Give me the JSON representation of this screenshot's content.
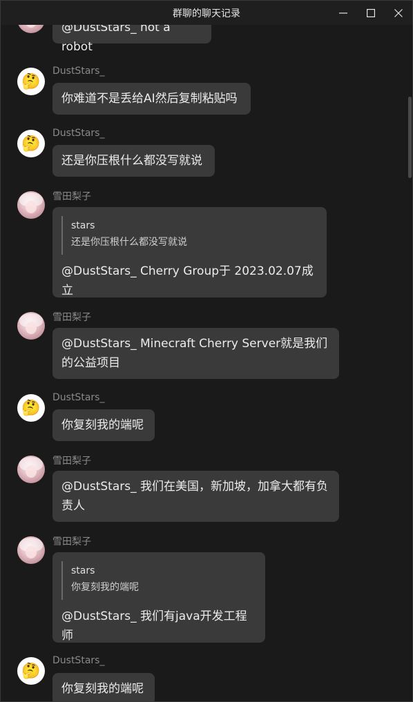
{
  "window": {
    "title": "群聊的聊天记录"
  },
  "icons": {
    "minimize": "minimize-icon",
    "maximize": "maximize-icon",
    "close": "close-icon",
    "thinking_emoji": "🤔"
  },
  "messages": [
    {
      "sender": "",
      "avatar": "photo",
      "text": "@DustStars_ not a robot"
    },
    {
      "sender": "DustStars_",
      "avatar": "emoji",
      "text": "你难道不是丢给AI然后复制粘贴吗"
    },
    {
      "sender": "DustStars_",
      "avatar": "emoji",
      "text": "还是你压根什么都没写就说"
    },
    {
      "sender": "雪田梨子",
      "avatar": "photo",
      "quote": {
        "name": "stars",
        "text": "还是你压根什么都没写就说"
      },
      "text": "@DustStars_ Cherry Group于 2023.02.07成立"
    },
    {
      "sender": "雪田梨子",
      "avatar": "photo",
      "text": "@DustStars_ Minecraft Cherry Server就是我们的公益项目"
    },
    {
      "sender": "DustStars_",
      "avatar": "emoji",
      "text": "你复刻我的端呢"
    },
    {
      "sender": "雪田梨子",
      "avatar": "photo",
      "text": "@DustStars_ 我们在美国，新加坡，加拿大都有负责人"
    },
    {
      "sender": "雪田梨子",
      "avatar": "photo",
      "quote": {
        "name": "stars",
        "text": "你复刻我的端呢"
      },
      "text": "@DustStars_ 我们有java开发工程师"
    },
    {
      "sender": "DustStars_",
      "avatar": "emoji",
      "text": "你复刻我的端呢"
    }
  ]
}
